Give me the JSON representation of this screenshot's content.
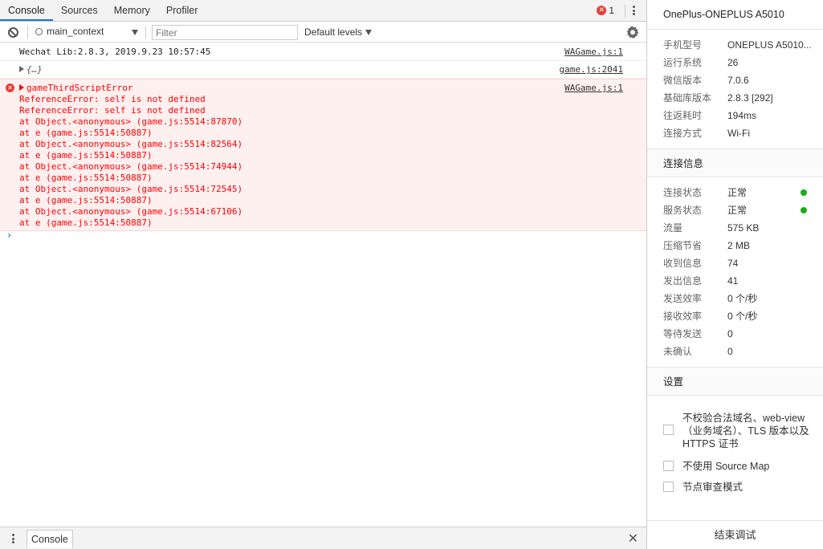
{
  "devtools": {
    "tabs": [
      "Console",
      "Sources",
      "Memory",
      "Profiler"
    ],
    "error_count": "1",
    "context": "main_context",
    "filter_placeholder": "Filter",
    "levels": "Default levels"
  },
  "console": {
    "log1": {
      "text": "Wechat Lib:2.8.3, 2019.9.23 10:57:45",
      "source": "WAGame.js:1"
    },
    "log2": {
      "text": "{…}",
      "source": "game.js:2041"
    },
    "error": {
      "title": "gameThirdScriptError",
      "source": "WAGame.js:1",
      "lines": [
        "ReferenceError: self is not defined",
        "ReferenceError: self is not defined",
        "at Object.<anonymous> (game.js:5514:87870)",
        "at e (game.js:5514:50887)",
        "at Object.<anonymous> (game.js:5514:82564)",
        "at e (game.js:5514:50887)",
        "at Object.<anonymous> (game.js:5514:74944)",
        "at e (game.js:5514:50887)",
        "at Object.<anonymous> (game.js:5514:72545)",
        "at e (game.js:5514:50887)",
        "at Object.<anonymous> (game.js:5514:67106)",
        "at e (game.js:5514:50887)"
      ]
    },
    "prompt": "›"
  },
  "drawer": {
    "tab": "Console",
    "close": "✕"
  },
  "device": {
    "title": "OnePlus-ONEPLUS A5010",
    "info": [
      {
        "k": "手机型号",
        "v": "ONEPLUS A5010..."
      },
      {
        "k": "运行系统",
        "v": "26"
      },
      {
        "k": "微信版本",
        "v": "7.0.6"
      },
      {
        "k": "基础库版本",
        "v": "2.8.3 [292]"
      },
      {
        "k": "往返耗时",
        "v": "194ms"
      },
      {
        "k": "连接方式",
        "v": "Wi-Fi"
      }
    ],
    "conn_title": "连接信息",
    "conn": [
      {
        "k": "连接状态",
        "v": "正常"
      },
      {
        "k": "服务状态",
        "v": "正常"
      },
      {
        "k": "流量",
        "v": "575 KB"
      },
      {
        "k": "压缩节省",
        "v": "2 MB"
      },
      {
        "k": "收到信息",
        "v": "74"
      },
      {
        "k": "发出信息",
        "v": "41"
      },
      {
        "k": "发送效率",
        "v": "0 个/秒"
      },
      {
        "k": "接收效率",
        "v": "0 个/秒"
      },
      {
        "k": "等待发送",
        "v": "0"
      },
      {
        "k": "未确认",
        "v": "0"
      }
    ],
    "status_color": "#1aad19",
    "settings_title": "设置",
    "settings": [
      "不校验合法域名、web-view（业务域名）、TLS 版本以及 HTTPS 证书",
      "不使用 Source Map",
      "节点审查模式"
    ],
    "end_button": "结束调试"
  }
}
